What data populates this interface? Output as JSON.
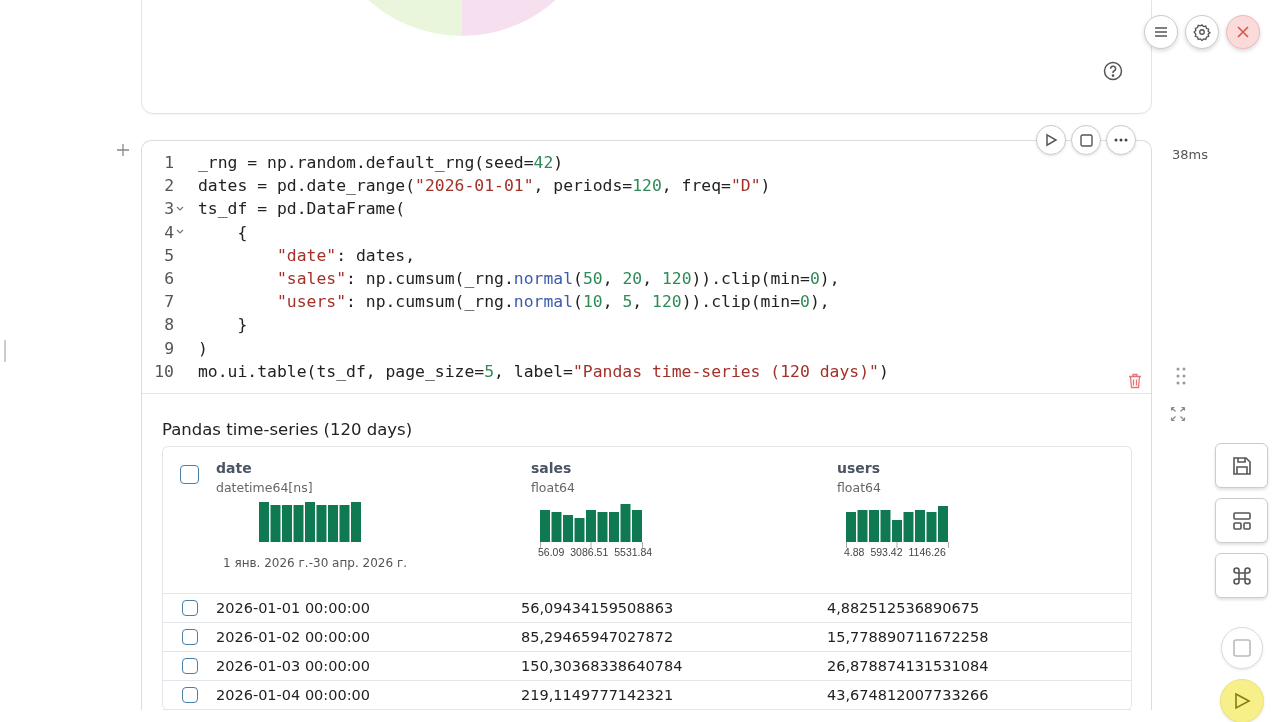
{
  "code_cell": {
    "run_time": "38ms",
    "lines": [
      {
        "number": "1",
        "foldable": false,
        "tokens": [
          {
            "kind": "plain",
            "text": "_rng = np.random.default_rng(seed="
          },
          {
            "kind": "num",
            "text": "42"
          },
          {
            "kind": "plain",
            "text": ")"
          }
        ]
      },
      {
        "number": "2",
        "foldable": false,
        "tokens": [
          {
            "kind": "plain",
            "text": "dates = pd.date_range("
          },
          {
            "kind": "str",
            "text": "\"2026-01-01\""
          },
          {
            "kind": "plain",
            "text": ", periods="
          },
          {
            "kind": "num",
            "text": "120"
          },
          {
            "kind": "plain",
            "text": ", freq="
          },
          {
            "kind": "str",
            "text": "\"D\""
          },
          {
            "kind": "plain",
            "text": ")"
          }
        ]
      },
      {
        "number": "3",
        "foldable": true,
        "tokens": [
          {
            "kind": "plain",
            "text": "ts_df = pd.DataFrame("
          }
        ]
      },
      {
        "number": "4",
        "foldable": true,
        "tokens": [
          {
            "kind": "plain",
            "text": "    {"
          }
        ]
      },
      {
        "number": "5",
        "foldable": false,
        "tokens": [
          {
            "kind": "str",
            "text": "        \"date\""
          },
          {
            "kind": "plain",
            "text": ": dates,"
          }
        ]
      },
      {
        "number": "6",
        "foldable": false,
        "tokens": [
          {
            "kind": "str",
            "text": "        \"sales\""
          },
          {
            "kind": "plain",
            "text": ": np.cumsum(_rng."
          },
          {
            "kind": "fn",
            "text": "normal"
          },
          {
            "kind": "plain",
            "text": "("
          },
          {
            "kind": "num",
            "text": "50"
          },
          {
            "kind": "plain",
            "text": ", "
          },
          {
            "kind": "num",
            "text": "20"
          },
          {
            "kind": "plain",
            "text": ", "
          },
          {
            "kind": "num",
            "text": "120"
          },
          {
            "kind": "plain",
            "text": ")).clip(min="
          },
          {
            "kind": "num",
            "text": "0"
          },
          {
            "kind": "plain",
            "text": "),"
          }
        ]
      },
      {
        "number": "7",
        "foldable": false,
        "tokens": [
          {
            "kind": "str",
            "text": "        \"users\""
          },
          {
            "kind": "plain",
            "text": ": np.cumsum(_rng."
          },
          {
            "kind": "fn",
            "text": "normal"
          },
          {
            "kind": "plain",
            "text": "("
          },
          {
            "kind": "num",
            "text": "10"
          },
          {
            "kind": "plain",
            "text": ", "
          },
          {
            "kind": "num",
            "text": "5"
          },
          {
            "kind": "plain",
            "text": ", "
          },
          {
            "kind": "num",
            "text": "120"
          },
          {
            "kind": "plain",
            "text": ")).clip(min="
          },
          {
            "kind": "num",
            "text": "0"
          },
          {
            "kind": "plain",
            "text": "),"
          }
        ]
      },
      {
        "number": "8",
        "foldable": false,
        "tokens": [
          {
            "kind": "plain",
            "text": "    }"
          }
        ]
      },
      {
        "number": "9",
        "foldable": false,
        "tokens": [
          {
            "kind": "plain",
            "text": ")"
          }
        ]
      },
      {
        "number": "10",
        "foldable": false,
        "tokens": [
          {
            "kind": "plain",
            "text": "mo.ui.table(ts_df, page_size="
          },
          {
            "kind": "num",
            "text": "5"
          },
          {
            "kind": "plain",
            "text": ", label="
          },
          {
            "kind": "str",
            "text": "\"Pandas time-series (120 days)\""
          },
          {
            "kind": "plain",
            "text": ")"
          }
        ]
      }
    ]
  },
  "output": {
    "label": "Pandas time-series (120 days)",
    "table": {
      "header_checkbox": {
        "checked": false
      },
      "columns": [
        {
          "name": "date",
          "dtype": "datetime64[ns]",
          "range_label": "1 янв. 2026 г.-30 апр. 2026 г."
        },
        {
          "name": "sales",
          "dtype": "float64",
          "axis_labels": [
            "56.09",
            "3086.51",
            "5531.84"
          ]
        },
        {
          "name": "users",
          "dtype": "float64",
          "axis_labels": [
            "4.88",
            "593.42",
            "1146.26"
          ]
        }
      ],
      "rows": [
        {
          "selected": false,
          "cells": [
            "2026-01-01 00:00:00",
            "56,09434159508863",
            "4,882512536890675"
          ]
        },
        {
          "selected": false,
          "cells": [
            "2026-01-02 00:00:00",
            "85,29465947027872",
            "15,778890711672258"
          ]
        },
        {
          "selected": false,
          "cells": [
            "2026-01-03 00:00:00",
            "150,30368338640784",
            "26,878874131531084"
          ]
        },
        {
          "selected": false,
          "cells": [
            "2026-01-04 00:00:00",
            "219,1149777142321",
            "43,674812007733266"
          ]
        }
      ]
    }
  }
}
